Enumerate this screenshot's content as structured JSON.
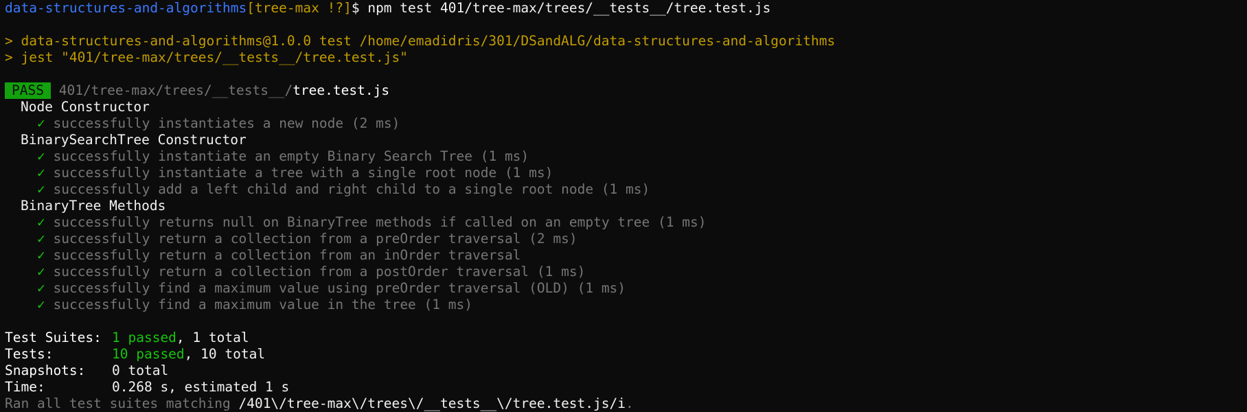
{
  "prompt": {
    "repo": "data-structures-and-algorithms",
    "branch": "[tree-max !?]",
    "symbol": "$",
    "command": "npm test 401/tree-max/trees/__tests__/tree.test.js"
  },
  "npm": {
    "line1": "> data-structures-and-algorithms@1.0.0 test /home/emadidris/301/DSandALG/data-structures-and-algorithms",
    "line2": "> jest \"401/tree-max/trees/__tests__/tree.test.js\""
  },
  "result": {
    "badge": "PASS",
    "path": "401/tree-max/trees/__tests__/",
    "file": "tree.test.js"
  },
  "check_glyph": "✓",
  "groups": [
    {
      "name": "Node Constructor",
      "tests": [
        "successfully instantiates a new node (2 ms)"
      ]
    },
    {
      "name": "BinarySearchTree Constructor",
      "tests": [
        "successfully instantiate an empty Binary Search Tree (1 ms)",
        "successfully instantiate a tree with a single root node (1 ms)",
        "successfully add a left child and right child to a single root node (1 ms)"
      ]
    },
    {
      "name": "BinaryTree Methods",
      "tests": [
        "successfully returns null on BinaryTree methods if called on an empty tree (1 ms)",
        "successfully return a collection from a preOrder traversal (2 ms)",
        "successfully return a collection from an inOrder traversal",
        "successfully return a collection from a postOrder traversal (1 ms)",
        "successfully find a maximum value using preOrder traversal (OLD) (1 ms)",
        "successfully find a maximum value in the tree (1 ms)"
      ]
    }
  ],
  "summary": {
    "suites_label": "Test Suites:",
    "suites_passed": "1 passed",
    "suites_total": ", 1 total",
    "tests_label": "Tests:",
    "tests_passed": "10 passed",
    "tests_total": ", 10 total",
    "snapshots_label": "Snapshots:",
    "snapshots_value": "0 total",
    "time_label": "Time:",
    "time_value": "0.268 s, estimated 1 s",
    "ran_prefix": "Ran all test suites matching ",
    "ran_pattern": "/401\\/tree-max\\/trees\\/__tests__\\/tree.test.js/i",
    "ran_suffix": "."
  },
  "colors": {
    "background": "#0c0c0c",
    "prompt_repo": "#3b78ff",
    "npm_lines": "#c19c00",
    "pass_badge": "#13a10e",
    "check": "#16c60c",
    "muted": "#767676"
  }
}
